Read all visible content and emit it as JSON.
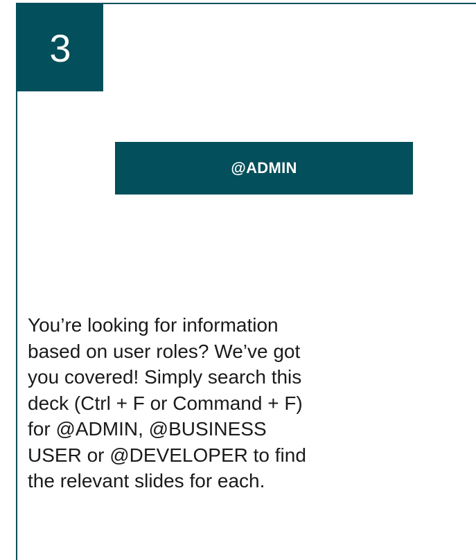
{
  "slide": {
    "number": "3",
    "role_banner": "@ADMIN",
    "description": "You’re looking for information\nbased on user roles? We’ve got\nyou covered! Simply search this\ndeck (Ctrl + F or Command + F)\nfor @ADMIN, @BUSINESS\nUSER or @DEVELOPER to find\nthe relevant slides for each."
  },
  "colors": {
    "accent": "#034f5b",
    "text": "#1a1a1a",
    "background": "#ffffff"
  }
}
